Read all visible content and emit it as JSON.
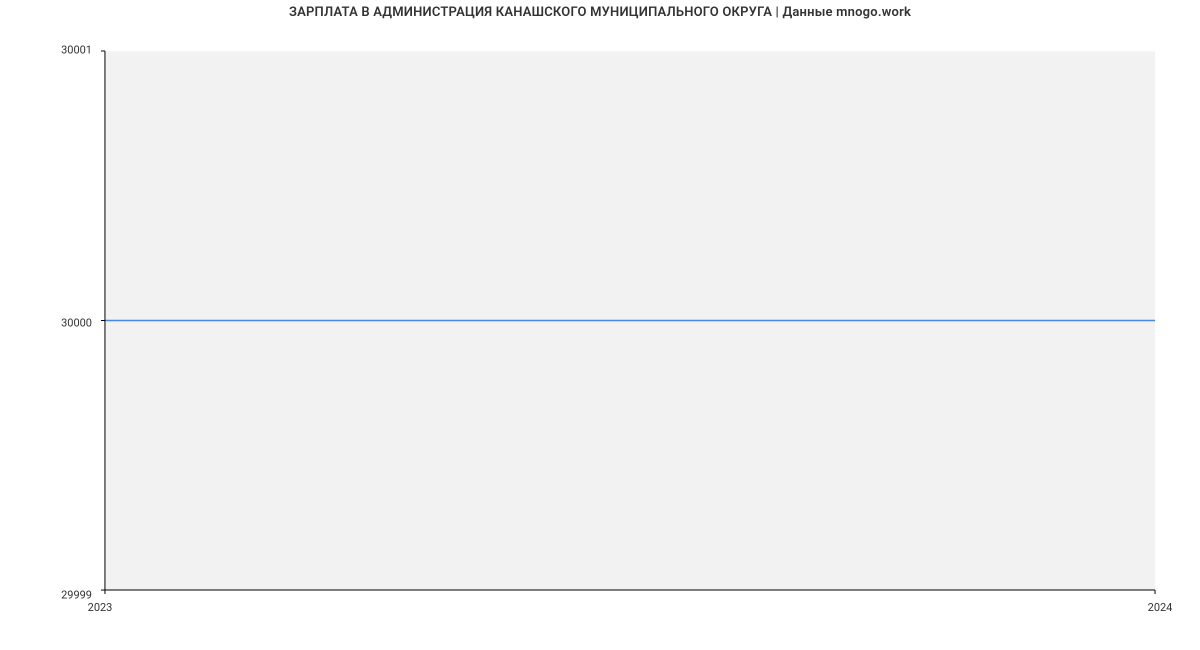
{
  "chart_data": {
    "type": "line",
    "title": "ЗАРПЛАТА В АДМИНИСТРАЦИЯ КАНАШСКОГО МУНИЦИПАЛЬНОГО ОКРУГА | Данные mnogo.work",
    "x": [
      2023,
      2024
    ],
    "values": [
      30000,
      30000
    ],
    "xlabel": "",
    "ylabel": "",
    "ylim": [
      29999,
      30001
    ],
    "xlim": [
      2023,
      2024
    ],
    "y_ticks": [
      {
        "value": 29999,
        "label": "29999"
      },
      {
        "value": 30000,
        "label": "30000"
      },
      {
        "value": 30001,
        "label": "30001"
      }
    ],
    "x_ticks": [
      {
        "value": 2023,
        "label": "2023"
      },
      {
        "value": 2024,
        "label": "2024"
      }
    ],
    "line_color": "#4a86e8",
    "plot_bg": "#f2f2f2"
  }
}
